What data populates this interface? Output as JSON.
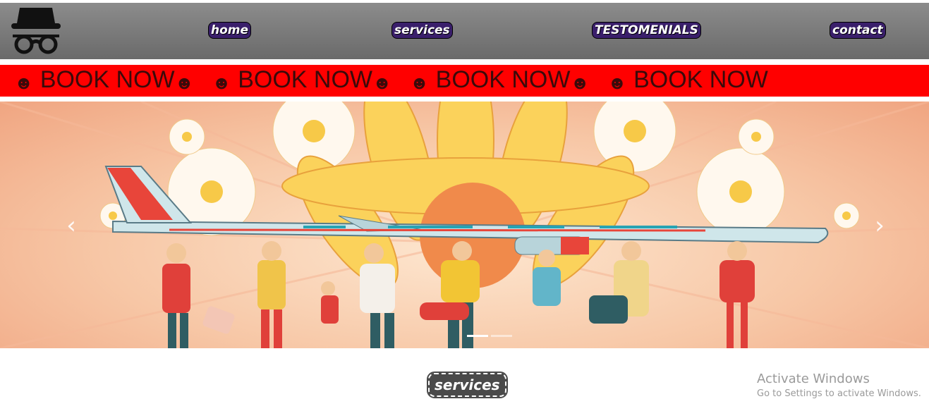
{
  "nav": {
    "links": [
      {
        "label": "home"
      },
      {
        "label": "services"
      },
      {
        "label": "TESTOMENIALS"
      },
      {
        "label": "contact"
      }
    ]
  },
  "marquee": {
    "items": [
      "BOOK NOW",
      "BOOK NOW",
      "BOOK NOW",
      "BOOK NOW"
    ],
    "icon": "smiley-icon",
    "color": "#ff0000"
  },
  "carousel": {
    "image_subject": "airplane carried by travelers in front of sunflowers",
    "prev_icon": "chevron-left-icon",
    "next_icon": "chevron-right-icon",
    "slides": 2,
    "active_slide": 1
  },
  "section": {
    "title": "services"
  },
  "watermark": {
    "title": "Activate Windows",
    "subtitle": "Go to Settings to activate Windows."
  }
}
